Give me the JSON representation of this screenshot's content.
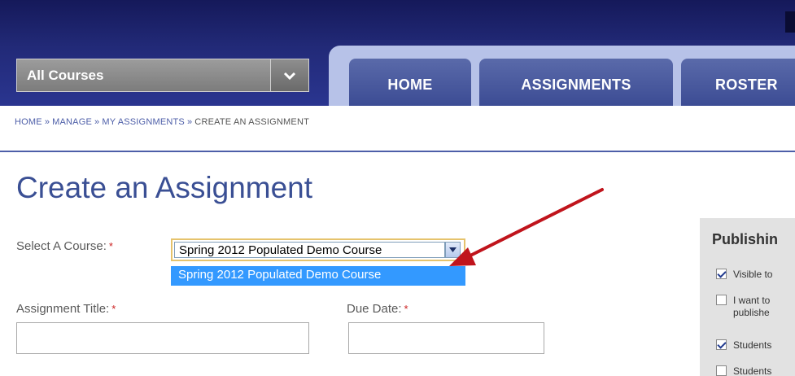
{
  "header": {
    "course_dropdown_label": "All Courses",
    "tabs": [
      {
        "label": "HOME"
      },
      {
        "label": "ASSIGNMENTS"
      },
      {
        "label": "ROSTER"
      }
    ]
  },
  "breadcrumb": {
    "items": [
      "HOME",
      "MANAGE",
      "MY ASSIGNMENTS"
    ],
    "separator": "»",
    "current": "CREATE AN ASSIGNMENT"
  },
  "page": {
    "title": "Create an Assignment"
  },
  "form": {
    "select_course_label": "Select A Course:",
    "required_marker": "*",
    "selected_course": "Spring 2012 Populated Demo Course",
    "dropdown_options": [
      "Spring 2012 Populated Demo Course"
    ],
    "assignment_title_label": "Assignment Title:",
    "assignment_title_value": "",
    "due_date_label": "Due Date:",
    "due_date_value": ""
  },
  "publishing": {
    "title": "Publishin",
    "options": [
      {
        "text": "Visible to",
        "checked": true
      },
      {
        "text": "I want to",
        "text2": "publishe",
        "checked": false
      },
      {
        "text": "Students",
        "checked": true
      },
      {
        "text": "Students",
        "checked": false
      }
    ]
  },
  "colors": {
    "header_navy": "#222a78",
    "tab_blue": "#4a5aa0",
    "link_blue": "#4d5ea8",
    "title_blue": "#3a4f94",
    "selection_blue": "#3399ff",
    "annotation_arrow": "#c0141c",
    "required_red": "#cc2222"
  }
}
